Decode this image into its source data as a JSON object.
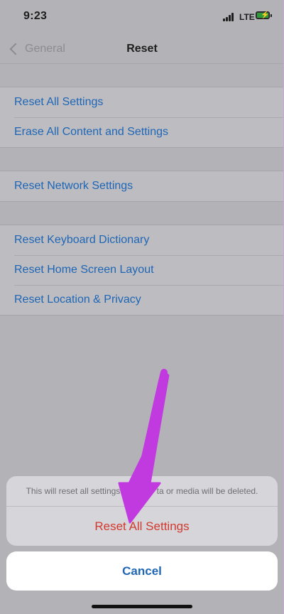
{
  "status_bar": {
    "time": "9:23",
    "network": "LTE",
    "icons": [
      "signal-icon",
      "battery-charging-icon"
    ]
  },
  "nav": {
    "back_label": "General",
    "title": "Reset"
  },
  "groups": [
    {
      "items": [
        {
          "label": "Reset All Settings"
        },
        {
          "label": "Erase All Content and Settings"
        }
      ]
    },
    {
      "items": [
        {
          "label": "Reset Network Settings"
        }
      ]
    },
    {
      "items": [
        {
          "label": "Reset Keyboard Dictionary"
        },
        {
          "label": "Reset Home Screen Layout"
        },
        {
          "label": "Reset Location & Privacy"
        }
      ]
    }
  ],
  "action_sheet": {
    "message_start": "This will reset all settings.",
    "message_end": "ta or media will be deleted.",
    "confirm_label": "Reset All Settings",
    "cancel_label": "Cancel"
  },
  "colors": {
    "accent": "#1e66b5",
    "destructive": "#d23a30",
    "annotation": "#c13ae0"
  }
}
